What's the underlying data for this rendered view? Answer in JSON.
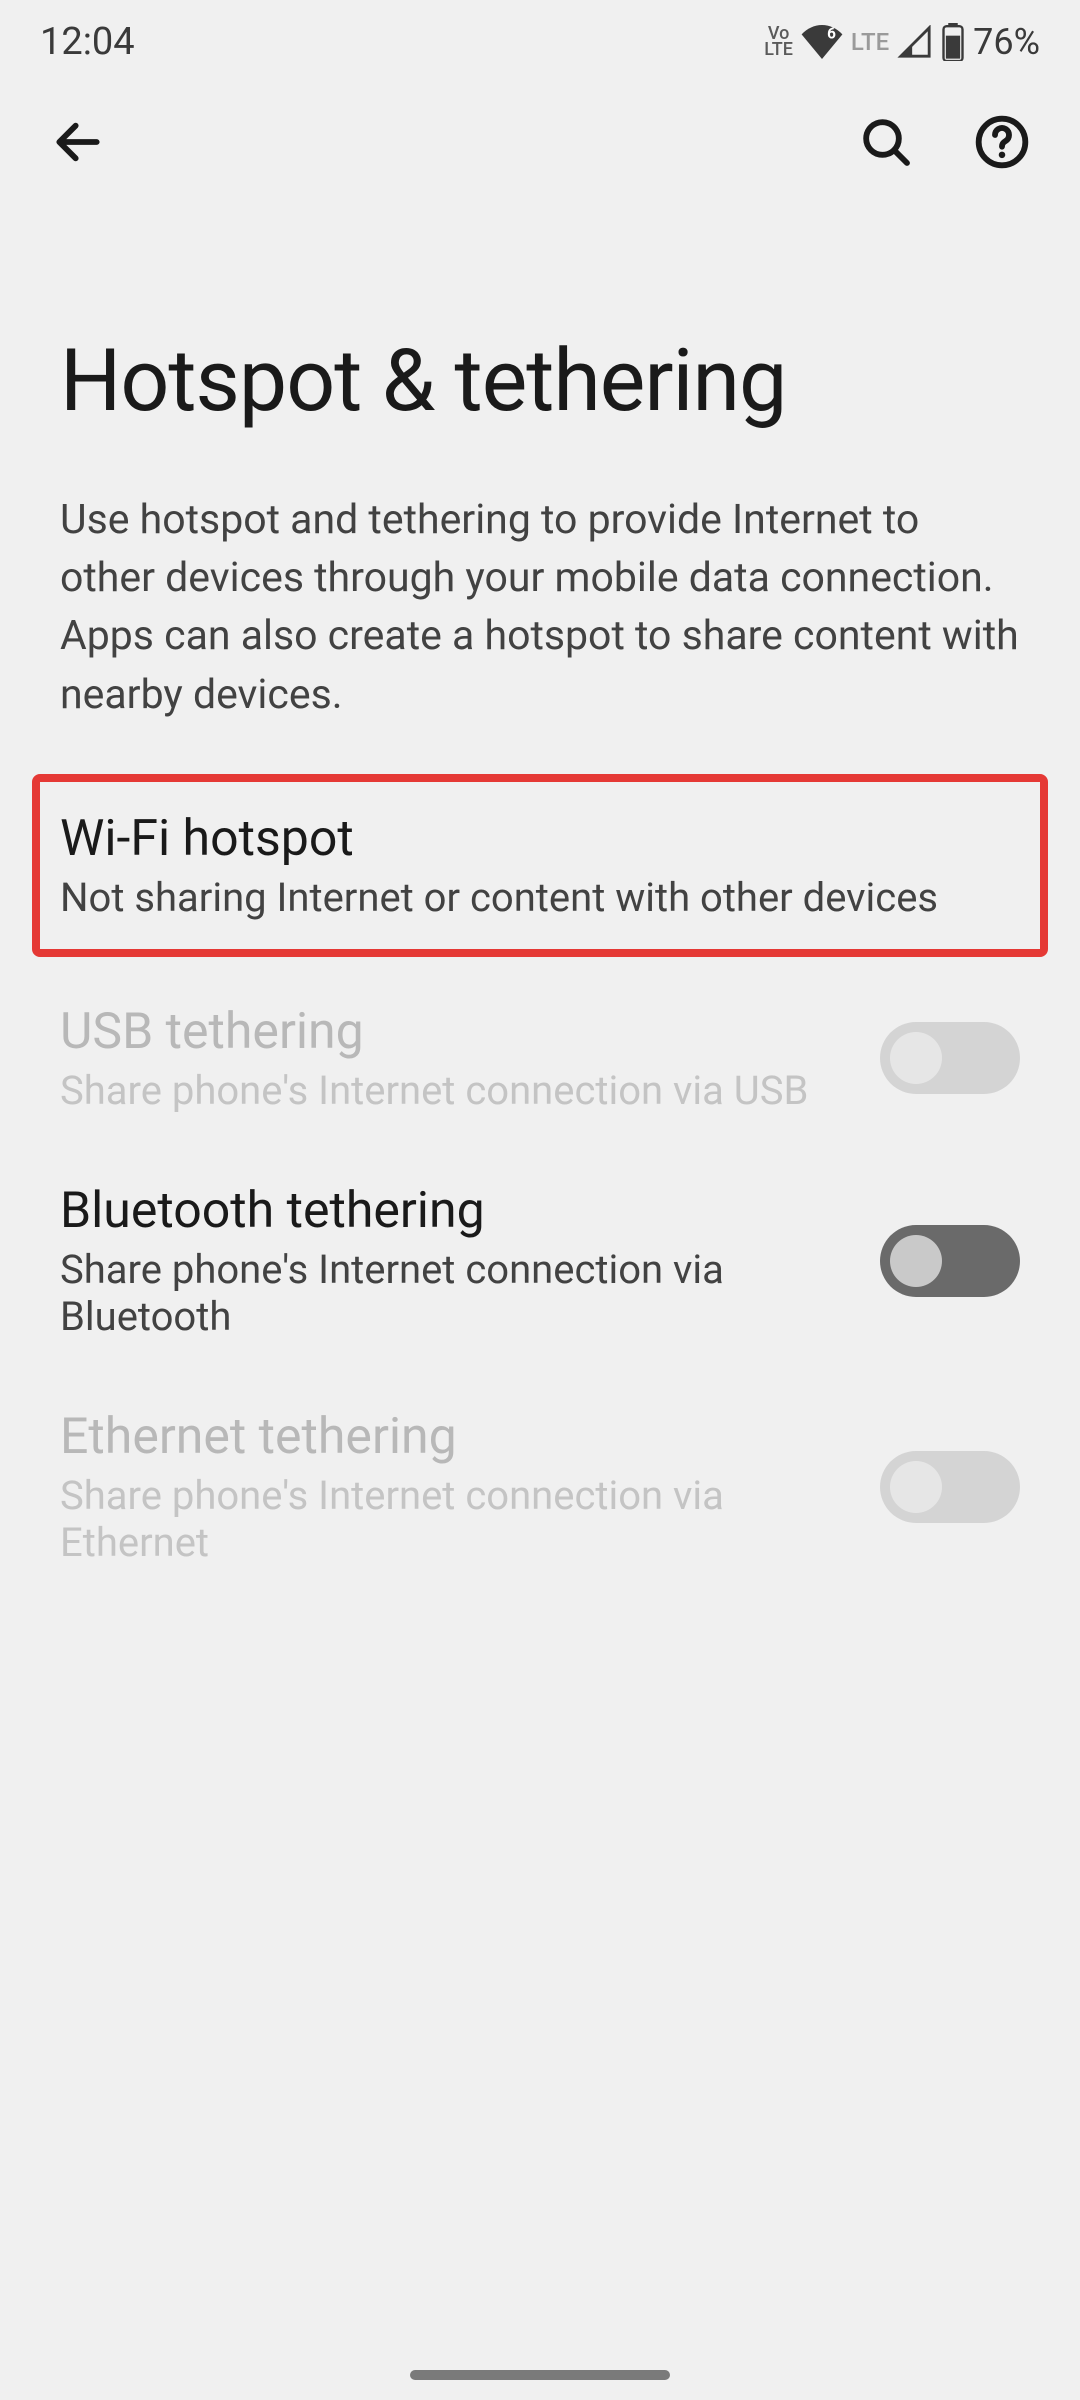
{
  "statusBar": {
    "time": "12:04",
    "volte": "Vo\nLTE",
    "wifiBadge": "6",
    "lte": "LTE",
    "battery": "76%"
  },
  "page": {
    "title": "Hotspot & tethering",
    "description": "Use hotspot and tethering to provide Internet to other devices through your mobile data connection. Apps can also create a hotspot to share content with nearby devices."
  },
  "settings": [
    {
      "title": "Wi-Fi hotspot",
      "subtitle": "Not sharing Internet or content with other devices",
      "hasToggle": false,
      "highlighted": true,
      "disabled": false
    },
    {
      "title": "USB tethering",
      "subtitle": "Share phone's Internet connection via USB",
      "hasToggle": true,
      "toggleOn": false,
      "highlighted": false,
      "disabled": true
    },
    {
      "title": "Bluetooth tethering",
      "subtitle": "Share phone's Internet connection via Bluetooth",
      "hasToggle": true,
      "toggleOn": false,
      "highlighted": false,
      "disabled": false
    },
    {
      "title": "Ethernet tethering",
      "subtitle": "Share phone's Internet connection via Ethernet",
      "hasToggle": true,
      "toggleOn": false,
      "highlighted": false,
      "disabled": true
    }
  ]
}
